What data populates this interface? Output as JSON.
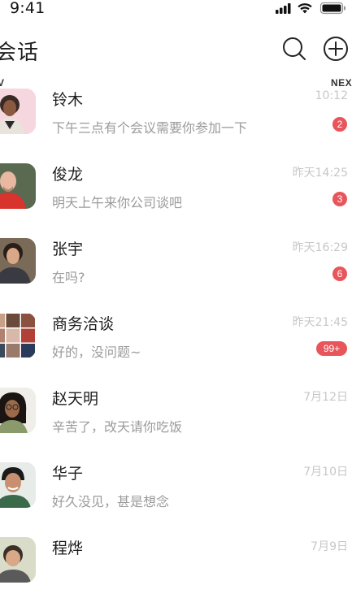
{
  "status_bar": {
    "time": "9:41"
  },
  "header": {
    "title": "会话",
    "search_icon": "search-icon",
    "add_icon": "plus-circle-icon"
  },
  "edge_labels": {
    "left": "V",
    "right": "NEX"
  },
  "conversations": [
    {
      "name": "铃木",
      "preview": "下午三点有个会议需要你参加一下",
      "time": "10:12",
      "badge": "2",
      "avatar": "person-photo"
    },
    {
      "name": "俊龙",
      "preview": "明天上午来你公司谈吧",
      "time": "昨天14:25",
      "badge": "3",
      "avatar": "person-photo"
    },
    {
      "name": "张宇",
      "preview": "在吗?",
      "time": "昨天16:29",
      "badge": "6",
      "avatar": "person-photo"
    },
    {
      "name": "商务洽谈",
      "preview": "好的，没问题~",
      "time": "昨天21:45",
      "badge": "99+",
      "avatar": "group-photo"
    },
    {
      "name": "赵天明",
      "preview": "辛苦了，改天请你吃饭",
      "time": "7月12日",
      "badge": "",
      "avatar": "person-photo"
    },
    {
      "name": "华子",
      "preview": "好久没见，甚是想念",
      "time": "7月10日",
      "badge": "",
      "avatar": "person-photo"
    },
    {
      "name": "程烨",
      "preview": "",
      "time": "7月9日",
      "badge": "",
      "avatar": "person-photo"
    }
  ],
  "colors": {
    "badge": "#e8555a",
    "muted_text": "#9b9b9b",
    "time_text": "#c7c7c7"
  }
}
